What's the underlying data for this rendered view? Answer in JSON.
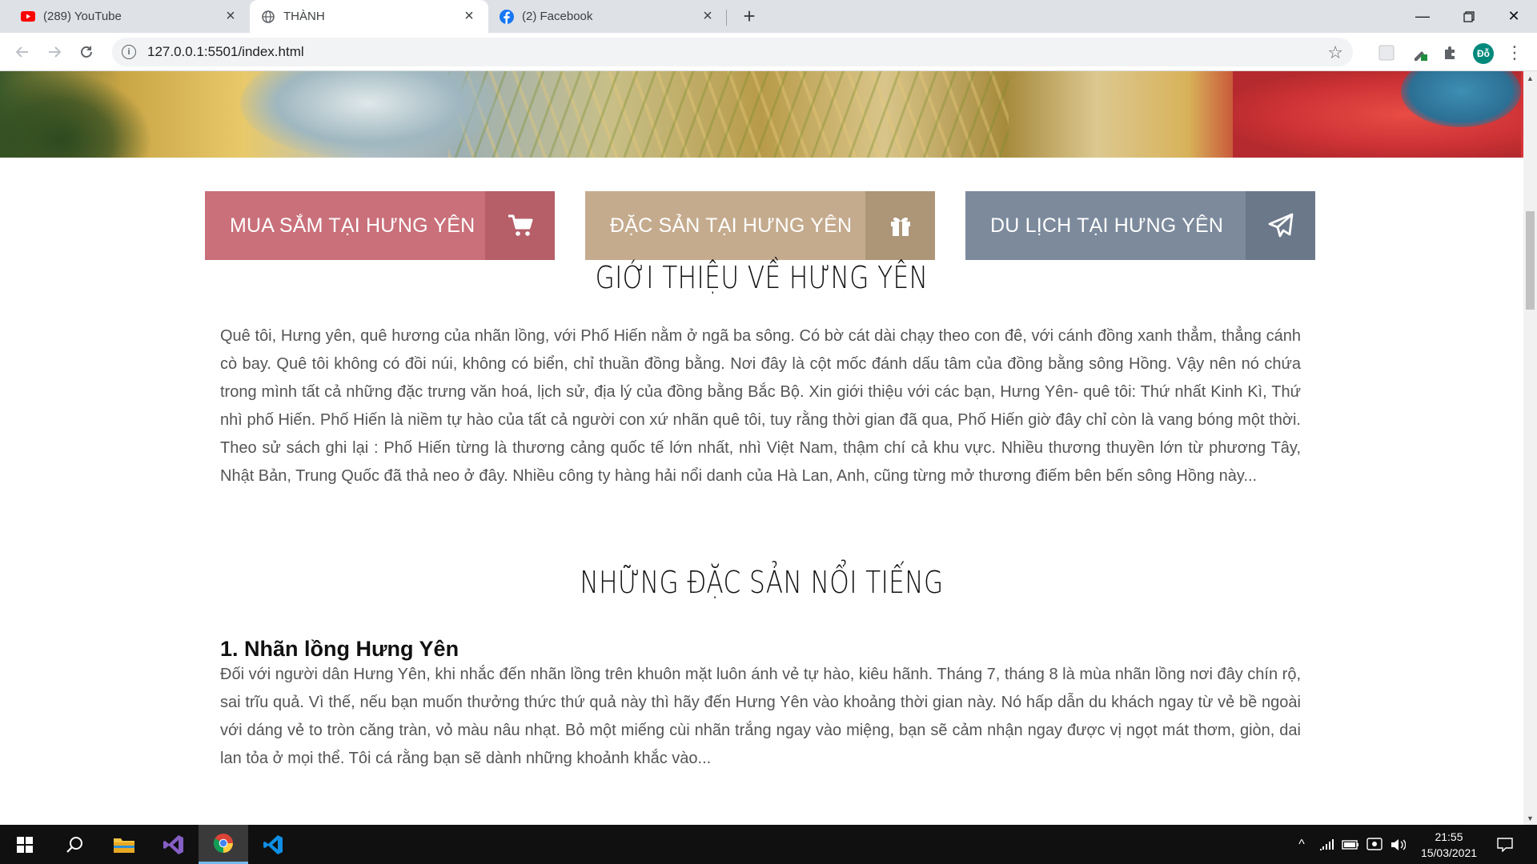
{
  "browser": {
    "tabs": [
      {
        "label": "(289) YouTube",
        "icon": "youtube-icon"
      },
      {
        "label": "THÀNH",
        "icon": "globe-icon",
        "active": true
      },
      {
        "label": "(2) Facebook",
        "icon": "facebook-icon"
      }
    ],
    "url": "127.0.0.1:5501/index.html",
    "profile_initials": "Đỗ"
  },
  "page": {
    "categories": [
      {
        "label": "MUA SẮM TẠI HƯNG YÊN",
        "icon": "shopping-cart-icon",
        "color": "#c9707a",
        "icon_bg": "#b65f69"
      },
      {
        "label": "ĐẶC SẢN TẠI HƯNG YÊN",
        "icon": "gift-icon",
        "color": "#c5ab8e",
        "icon_bg": "#ad9577"
      },
      {
        "label": "DU LỊCH TẠI HƯNG YÊN",
        "icon": "paper-plane-icon",
        "color": "#7c8a9c",
        "icon_bg": "#6b7889"
      }
    ],
    "intro_title": "GIỚI THIỆU VỀ HƯNG YÊN",
    "intro_text": "Quê tôi, Hưng yên, quê hương của nhãn lồng, với Phố Hiến nằm ở ngã ba sông. Có bờ cát dài chạy theo con đê, với cánh đồng xanh thẳm, thẳng cánh cò bay. Quê tôi không có đồi núi, không có biển, chỉ thuần đồng bằng. Nơi đây là cột mốc đánh dấu tâm của đồng bằng sông Hồng. Vậy nên nó chứa trong mình tất cả những đặc trưng văn hoá, lịch sử, địa lý của đồng bằng Bắc Bộ. Xin giới thiệu với các bạn, Hưng Yên- quê tôi: Thứ nhất Kinh Kì, Thứ nhì phố Hiến. Phố Hiến là niềm tự hào của tất cả người con xứ nhãn quê tôi, tuy rằng thời gian đã qua, Phố Hiến giờ đây chỉ còn là vang bóng một thời. Theo sử sách ghi lại : Phố Hiến từng là thương cảng quốc tế lớn nhất, nhì Việt Nam, thậm chí cả khu vực. Nhiều thương thuyền lớn từ phương Tây, Nhật Bản, Trung Quốc đã thả neo ở đây. Nhiều công ty hàng hải nổi danh của Hà Lan, Anh, cũng từng mở thương điếm bên bến sông Hồng này...",
    "specialties_title": "NHỮNG ĐẶC SẢN NỔI TIẾNG",
    "item1_title": "1. Nhãn lồng Hưng Yên",
    "item1_text": "Đối với người dân Hưng Yên, khi nhắc đến nhãn lồng trên khuôn mặt luôn ánh vẻ tự hào, kiêu hãnh. Tháng 7, tháng 8 là mùa nhãn lồng nơi đây chín rộ, sai trĩu quả. Vì thế, nếu bạn muốn thưởng thức thứ quả này thì hãy đến Hưng Yên vào khoảng thời gian này. Nó hấp dẫn du khách ngay từ vẻ bề ngoài với dáng vẻ to tròn căng tràn, vỏ màu nâu nhạt. Bỏ một miếng cùi nhãn trắng ngay vào miệng, bạn sẽ cảm nhận ngay được vị ngọt mát thơm, giòn, dai lan tỏa ở mọi thể. Tôi cá rằng bạn sẽ dành những khoảnh khắc vào..."
  },
  "taskbar": {
    "time": "21:55",
    "date": "15/03/2021"
  }
}
